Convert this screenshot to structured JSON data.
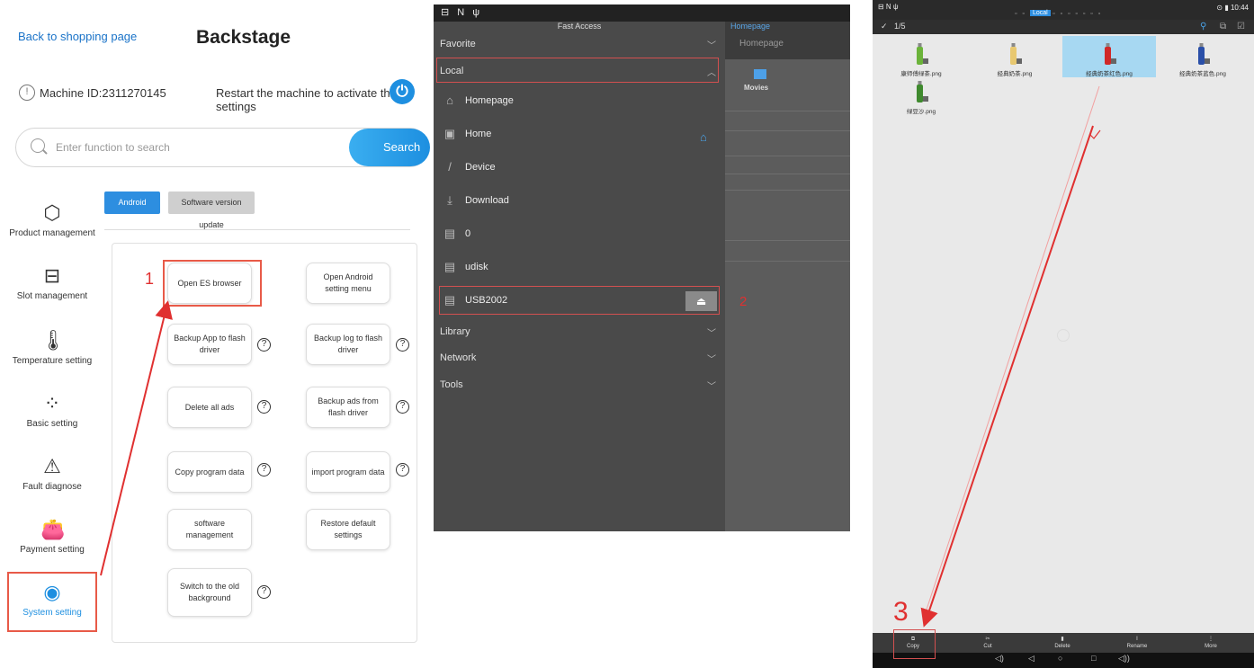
{
  "backstage": {
    "back_link": "Back to shopping page",
    "title": "Backstage",
    "machine_id": "Machine ID:2311270145",
    "restart_notice": "Restart the machine to activate the settings",
    "search_placeholder": "Enter function to search",
    "search_button": "Search",
    "sidebar": [
      {
        "label": "Product management",
        "icon": "cube-icon"
      },
      {
        "label": "Slot management",
        "icon": "box-icon"
      },
      {
        "label": "Temperature setting",
        "icon": "thermometer-icon"
      },
      {
        "label": "Basic setting",
        "icon": "grid-icon"
      },
      {
        "label": "Fault diagnose",
        "icon": "warning-icon"
      },
      {
        "label": "Payment setting",
        "icon": "wallet-icon"
      },
      {
        "label": "System setting",
        "icon": "android-icon"
      }
    ],
    "tabs": [
      "Android system",
      "Software version update"
    ],
    "functions": {
      "open_es": "Open ES browser",
      "open_android": "Open Android setting menu",
      "backup_app": "Backup App to flash driver",
      "backup_log": "Backup log to flash driver",
      "delete_ads": "Delete all ads",
      "backup_ads": "Backup ads from flash driver",
      "copy_program": "Copy program data",
      "import_program": "import program data",
      "software_mgmt": "software management",
      "restore_default": "Restore default settings",
      "switch_old": "Switch to the old background"
    },
    "help_glyph": "?",
    "step_label": "1"
  },
  "es_browser": {
    "status_icons": "⊟ N ψ",
    "title": "Fast Access",
    "bg_homepage_tab": "Homepage",
    "bg_homepage": "Homepage",
    "bg_movies": "Movies",
    "sections": {
      "favorite": "Favorite",
      "local": "Local",
      "library": "Library",
      "network": "Network",
      "tools": "Tools"
    },
    "local_items": [
      {
        "label": "Homepage",
        "icon": "home-outline-icon"
      },
      {
        "label": "Home",
        "icon": "folder-home-icon"
      },
      {
        "label": "Device",
        "icon": "slash-icon"
      },
      {
        "label": "Download",
        "icon": "download-icon"
      },
      {
        "label": "0",
        "icon": "sdcard-icon"
      },
      {
        "label": "udisk",
        "icon": "sdcard-icon"
      },
      {
        "label": "USB2002",
        "icon": "usb-drive-icon"
      }
    ],
    "step_label": "2"
  },
  "file_browser": {
    "status_left": "⊟ N ψ",
    "status_right": "⊙ ▮ 10:44",
    "tab_local": "Local",
    "selection_count": "1/5",
    "files": [
      {
        "name": "康师傅绿茶.png",
        "color": "#6bb33a"
      },
      {
        "name": "经典奶茶.png",
        "color": "#e8c870"
      },
      {
        "name": "经典奶茶红色.png",
        "color": "#d02828"
      },
      {
        "name": "经典奶茶蓝色.png",
        "color": "#2a4fa8"
      },
      {
        "name": "绿豆沙.png",
        "color": "#3f8a2e"
      }
    ],
    "actions": [
      "Copy",
      "Cut",
      "Delete",
      "Rename",
      "More"
    ],
    "step_label": "3"
  },
  "colors": {
    "accent_blue": "#1e8fe0",
    "highlight_red": "#e85a48",
    "es_drawer": "#4a4a4a"
  }
}
